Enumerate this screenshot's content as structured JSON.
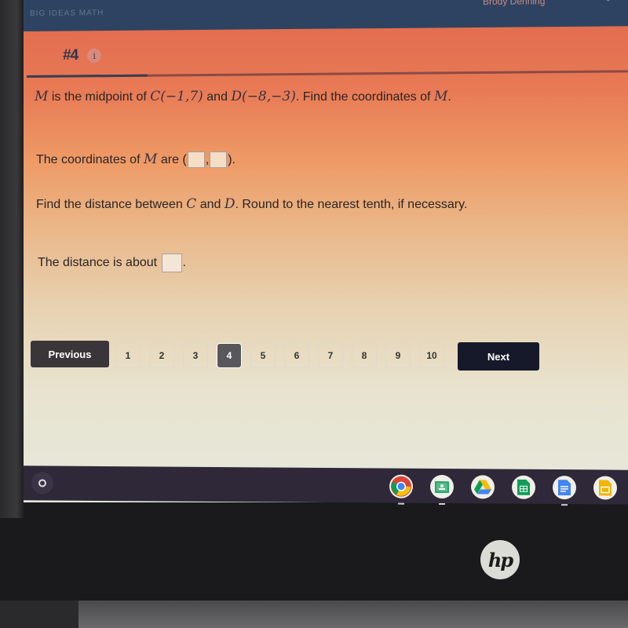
{
  "header": {
    "brand": "BIG IDEAS MATH",
    "user_name": "Brody Denning",
    "chevron": "⌄"
  },
  "question": {
    "number_label": "#4",
    "info_icon": "i",
    "progress_fraction": 0.2
  },
  "prompt1": {
    "var_m": "M",
    "text_a": " is the midpoint of ",
    "point_c": "C(−1,7)",
    "text_b": " and ",
    "point_d": "D(−8,−3)",
    "text_c": ". Find the coordinates of ",
    "var_m2": "M",
    "text_d": "."
  },
  "answer1": {
    "text_a": "The coordinates of ",
    "var_m": "M",
    "text_b": " are (",
    "comma": ",",
    "text_c": ").",
    "x_value": "",
    "y_value": ""
  },
  "prompt2": {
    "text_a": "Find the distance between ",
    "var_c": "C",
    "text_b": " and ",
    "var_d": "D",
    "text_c": ". Round to the nearest tenth, if necessary."
  },
  "answer2": {
    "text_a": "The distance is about ",
    "text_b": ".",
    "value": ""
  },
  "pager": {
    "previous_label": "Previous",
    "next_label": "Next",
    "pages": [
      "1",
      "2",
      "3",
      "4",
      "5",
      "6",
      "7",
      "8",
      "9",
      "10"
    ],
    "current_page": "4"
  },
  "shelf": {
    "launcher_icon": "launcher-circle-icon",
    "apps": [
      "chrome",
      "google-classroom",
      "google-drive",
      "google-sheets",
      "google-docs",
      "google-slides"
    ]
  },
  "device": {
    "logo": "hp"
  }
}
